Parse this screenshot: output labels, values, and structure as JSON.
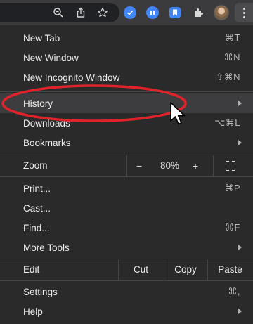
{
  "toolbar": {
    "icons": [
      "zoom-icon",
      "share-icon",
      "bookmark-star-icon",
      "extension-check-icon",
      "extension-pause-icon",
      "extension-bookmark-icon",
      "extensions-puzzle-icon",
      "profile-avatar",
      "more-menu-icon"
    ]
  },
  "menu": {
    "items": [
      {
        "label": "New Tab",
        "shortcut": "⌘T"
      },
      {
        "label": "New Window",
        "shortcut": "⌘N"
      },
      {
        "label": "New Incognito Window",
        "shortcut": "⇧⌘N"
      },
      {
        "label": "History",
        "submenu": true
      },
      {
        "label": "Downloads",
        "shortcut": "⌥⌘L"
      },
      {
        "label": "Bookmarks",
        "submenu": true
      },
      {
        "label": "Print...",
        "shortcut": "⌘P"
      },
      {
        "label": "Cast..."
      },
      {
        "label": "Find...",
        "shortcut": "⌘F"
      },
      {
        "label": "More Tools",
        "submenu": true
      },
      {
        "label": "Settings",
        "shortcut": "⌘,"
      },
      {
        "label": "Help",
        "submenu": true
      }
    ],
    "zoom": {
      "label": "Zoom",
      "minus": "−",
      "value": "80%",
      "plus": "+"
    },
    "edit": {
      "label": "Edit",
      "cut": "Cut",
      "copy": "Copy",
      "paste": "Paste"
    }
  },
  "colors": {
    "menu_bg": "#2a2a2b",
    "hover_bg": "#3d3d3f",
    "annotation_red": "#e0232b",
    "accent_blue": "#4285f4"
  }
}
